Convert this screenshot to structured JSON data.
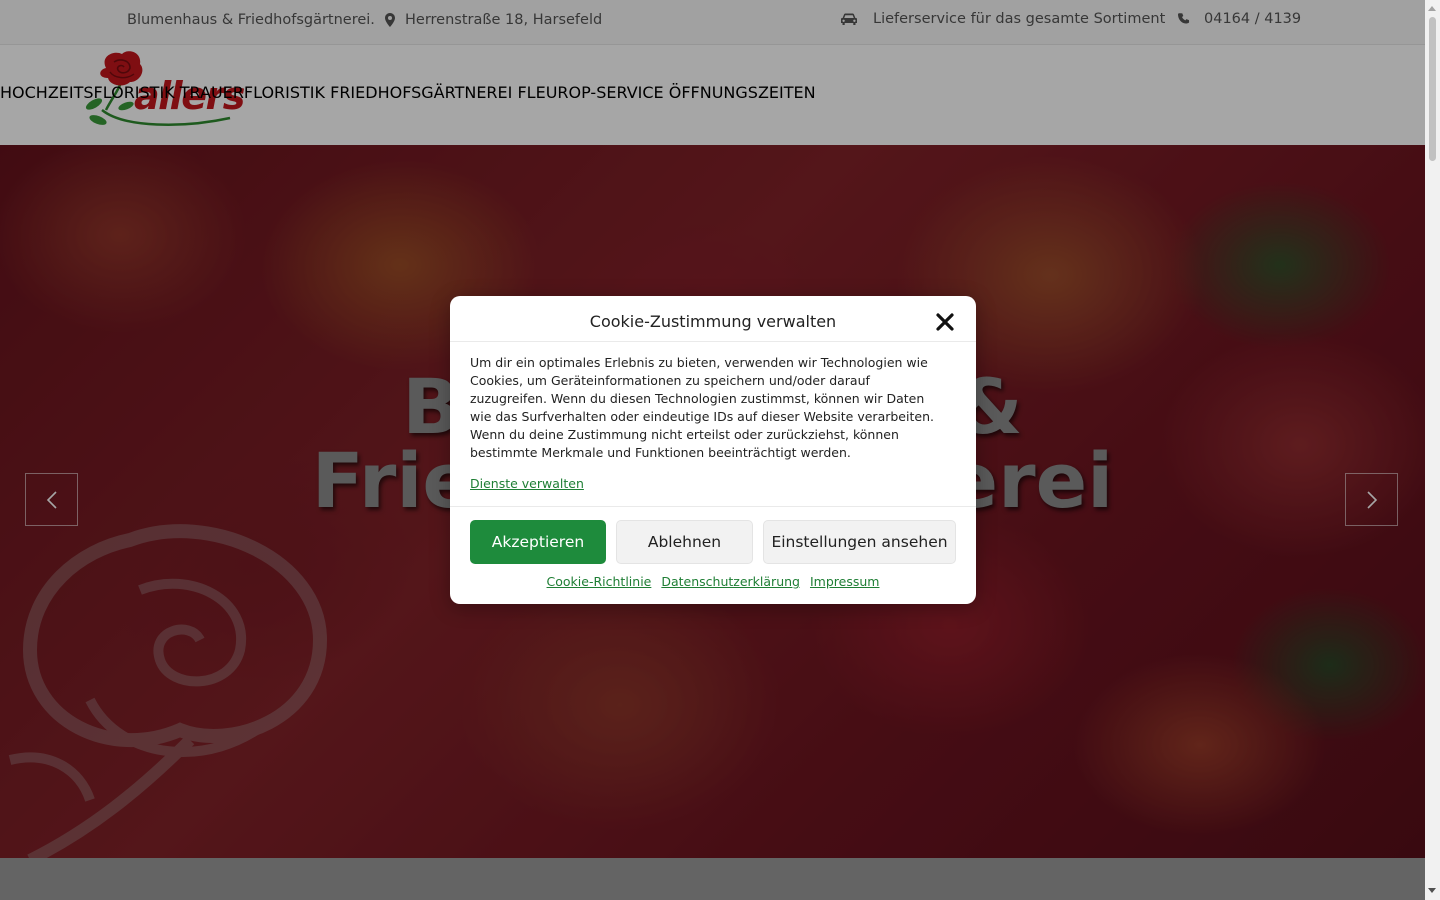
{
  "topbar": {
    "tagline": "Blumenhaus & Friedhofsgärtnerei.",
    "address": "Herrenstraße 18, Harsefeld",
    "delivery": "Lieferservice für das gesamte Sortiment",
    "phone": "04164 / 4139",
    "icons": [
      "map-marker-icon",
      "car-icon",
      "phone-icon"
    ]
  },
  "header": {
    "logo_text": "allers",
    "nav": [
      {
        "label": "HOCHZEITSFLORISTIK"
      },
      {
        "label": "TRAUERFLORISTIK"
      },
      {
        "label": "FRIEDHOFSGÄRTNEREI"
      },
      {
        "label": "FLEUROP-SERVICE"
      },
      {
        "label": "ÖFFNUNGSZEITEN"
      }
    ]
  },
  "hero": {
    "title_line1": "Blumenhaus &",
    "title_line2": "Friedhofsgärtnerei",
    "icons": [
      "chevron-left-icon",
      "chevron-right-icon"
    ]
  },
  "cookie_modal": {
    "title": "Cookie-Zustimmung verwalten",
    "body": "Um dir ein optimales Erlebnis zu bieten, verwenden wir Technologien wie Cookies, um Geräteinformationen zu speichern und/oder darauf zuzugreifen. Wenn du diesen Technologien zustimmst, können wir Daten wie das Surfverhalten oder eindeutige IDs auf dieser Website verarbeiten. Wenn du deine Zustimmung nicht erteilst oder zurückziehst, können bestimmte Merkmale und Funktionen beeinträchtigt werden.",
    "manage_link": "Dienste verwalten",
    "accept": "Akzeptieren",
    "deny": "Ablehnen",
    "settings": "Einstellungen ansehen",
    "links": [
      "Cookie-Richtlinie",
      "Datenschutzerklärung",
      "Impressum"
    ]
  },
  "colors": {
    "accent_green": "#1e8b3c",
    "logo_red": "#c4161c"
  }
}
